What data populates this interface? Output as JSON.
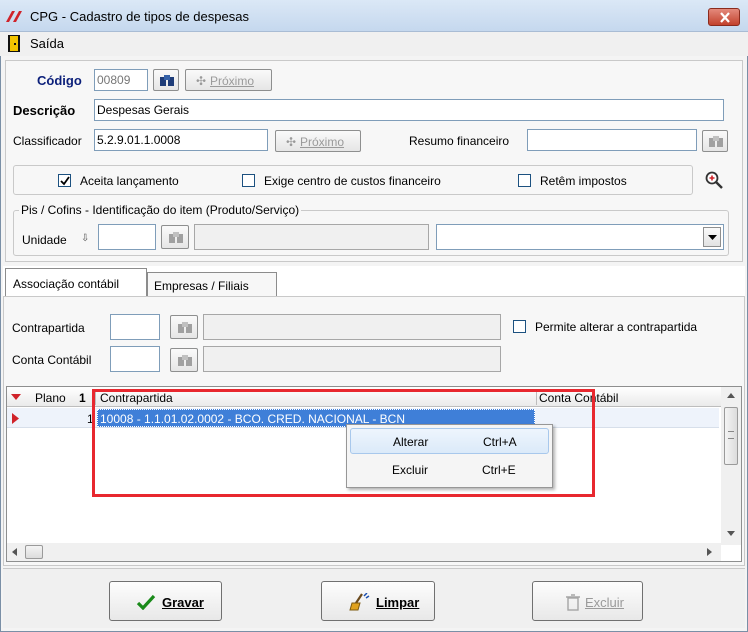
{
  "window": {
    "title": "CPG - Cadastro de tipos de despesas",
    "close_icon": "close-x-icon"
  },
  "menu": {
    "exit_label": "Saída"
  },
  "form": {
    "codigo_label": "Código",
    "codigo_value": "00809",
    "proximo_label": "Próximo",
    "descricao_label": "Descrição",
    "descricao_value": "Despesas Gerais",
    "classificador_label": "Classificador",
    "classificador_value": "5.2.9.01.1.0008",
    "proximo2_label": "Próximo",
    "resumo_label": "Resumo financeiro",
    "resumo_value": "",
    "checks": [
      {
        "label": "Aceita lançamento",
        "checked": true
      },
      {
        "label": "Exige centro de custos financeiro",
        "checked": false
      },
      {
        "label": "Retêm impostos",
        "checked": false
      }
    ],
    "pis_group_label": "Pis / Cofins - Identificação do item (Produto/Serviço)",
    "unidade_label": "Unidade"
  },
  "tabs": [
    {
      "label": "Associação contábil",
      "active": true
    },
    {
      "label": "Empresas / Filiais",
      "active": false
    }
  ],
  "assoc": {
    "contrapartida_label": "Contrapartida",
    "conta_label": "Conta Contábil",
    "permite_label": "Permite alterar a contrapartida"
  },
  "grid": {
    "columns": [
      "Plano",
      "Contrapartida",
      "Conta Contábil"
    ],
    "sort_marker": "1",
    "rows": [
      {
        "plano": "1",
        "contrapartida": "10008 - 1.1.01.02.0002 - BCO. CRED. NACIONAL - BCN",
        "conta": ""
      }
    ]
  },
  "context_menu": {
    "items": [
      {
        "label": "Alterar",
        "shortcut": "Ctrl+A"
      },
      {
        "label": "Excluir",
        "shortcut": "Ctrl+E"
      }
    ]
  },
  "footer": {
    "gravar": "Gravar",
    "limpar": "Limpar",
    "excluir": "Excluir"
  },
  "colors": {
    "highlight_frame": "#e8282f",
    "selection": "#3f7fd8",
    "accent_red": "#d0232a"
  }
}
